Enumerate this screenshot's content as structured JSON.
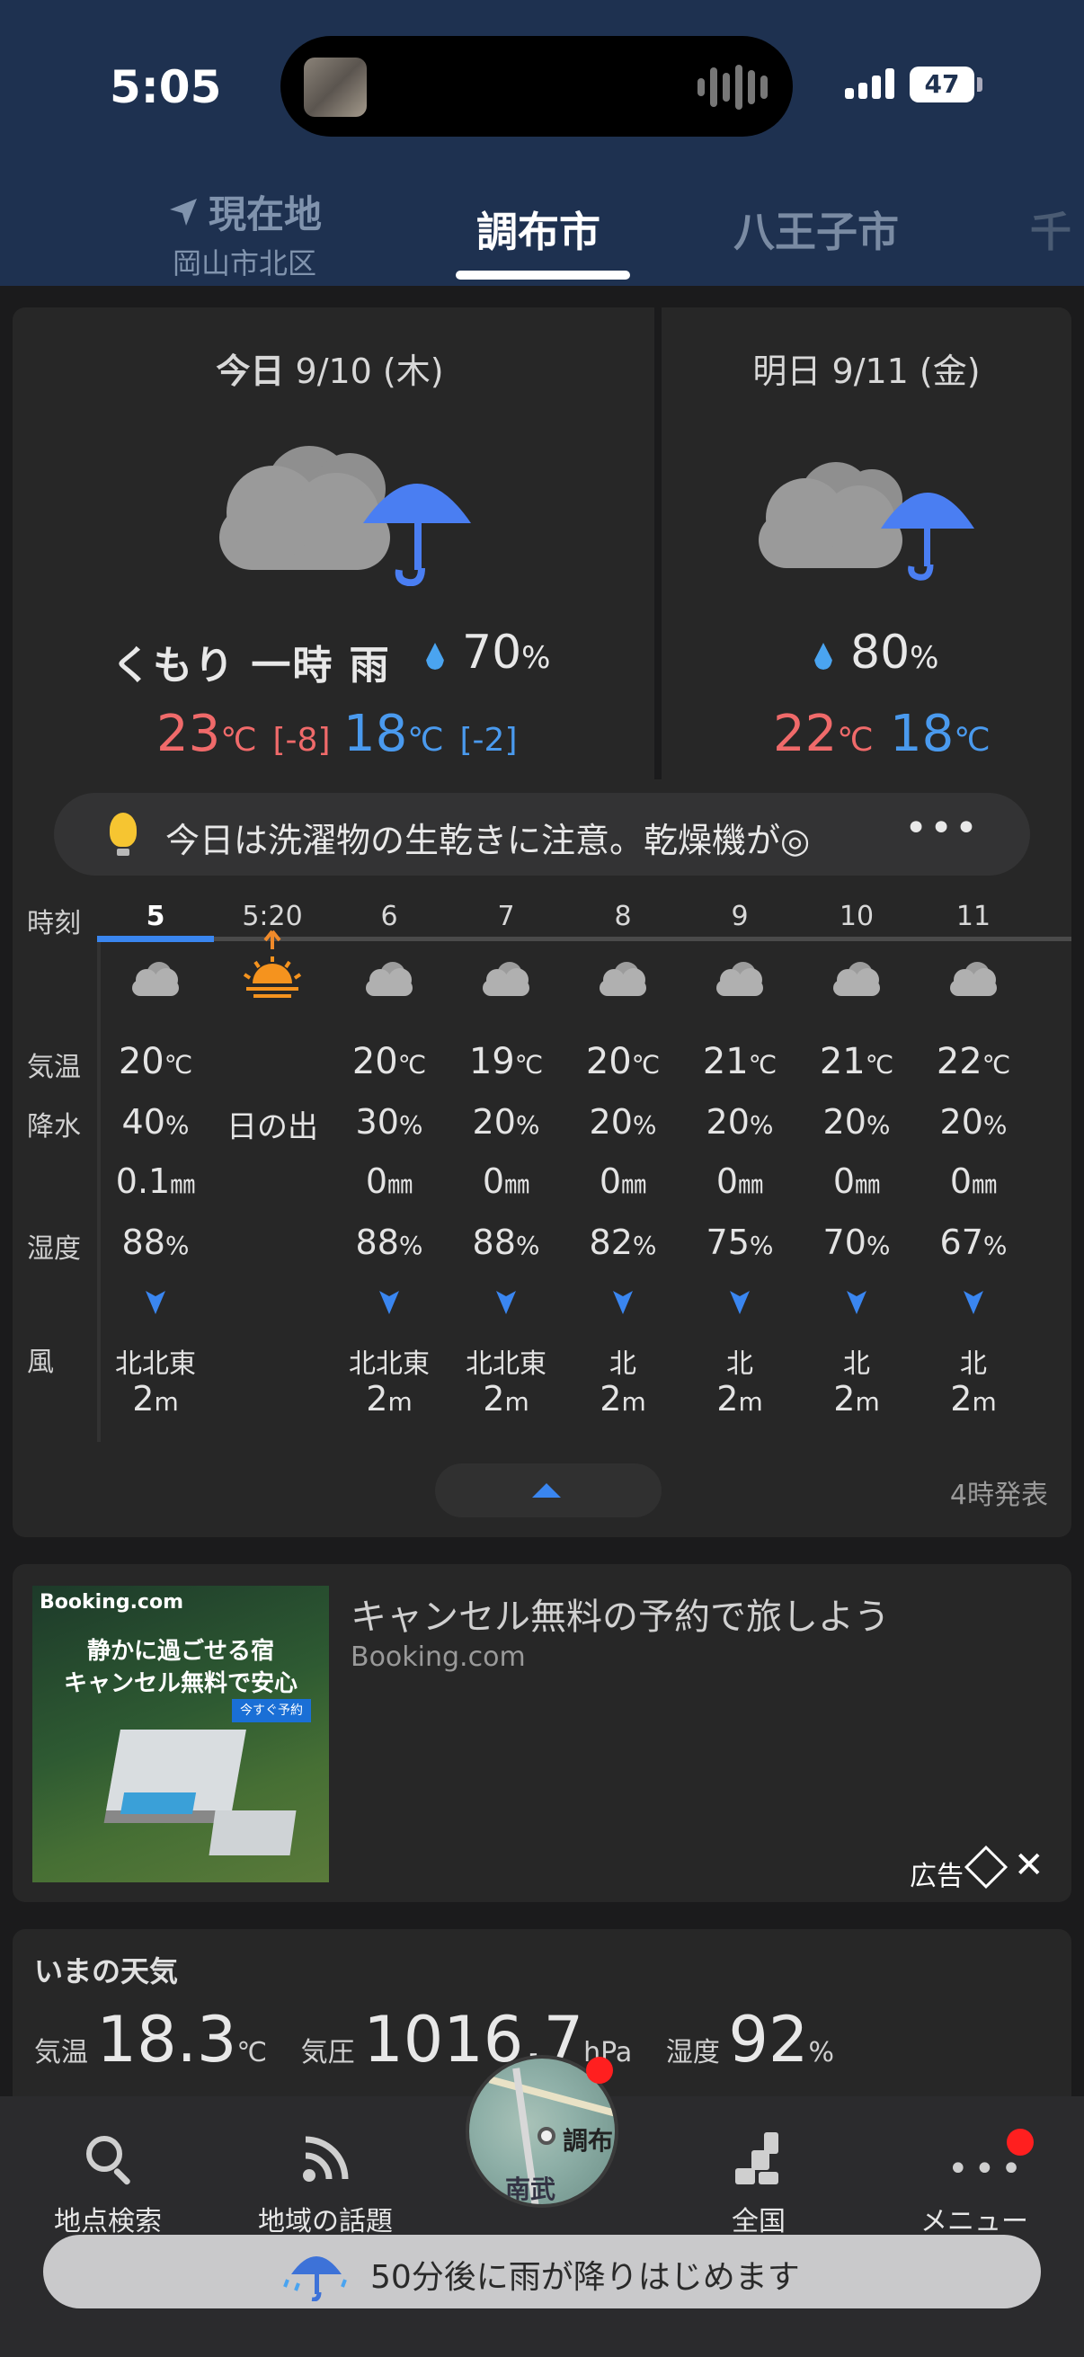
{
  "status_bar": {
    "time": "5:05",
    "battery": "47"
  },
  "location_tabs": {
    "current": {
      "title": "現在地",
      "subtitle": "岡山市北区"
    },
    "tabs": [
      "調布市",
      "八王子市",
      "千"
    ]
  },
  "forecast": {
    "today": {
      "label": "今日",
      "date": "9/10 (木)",
      "icon": "cloudy-with-rain-icon",
      "weather": "くもり 一時 雨",
      "pop_value": "70",
      "pop_unit": "%",
      "high": "23",
      "high_unit": "℃",
      "high_diff": "[-8]",
      "low": "18",
      "low_unit": "℃",
      "low_diff": "[-2]"
    },
    "tomorrow": {
      "label": "明日",
      "date": "9/11 (金)",
      "icon": "cloudy-with-rain-icon",
      "pop_value": "80",
      "pop_unit": "%",
      "high": "22",
      "high_unit": "℃",
      "low": "18",
      "low_unit": "℃"
    }
  },
  "advice": {
    "text": "今日は洗濯物の生乾きに注意。乾燥機が◎",
    "more": "•••"
  },
  "hourly": {
    "row_labels": {
      "time": "時刻",
      "temp": "気温",
      "rain": "降水",
      "humidity": "湿度",
      "wind": "風"
    },
    "columns": [
      {
        "time": "5",
        "icon": "cloud-icon",
        "temp": "20",
        "rain": "40",
        "mm": "0.1",
        "humidity": "88",
        "wind_dir": "北北東",
        "wind_speed": "2"
      },
      {
        "time": "5:20",
        "icon": "sunrise-icon",
        "sunrise": "日の出"
      },
      {
        "time": "6",
        "icon": "cloud-icon",
        "temp": "20",
        "rain": "30",
        "mm": "0",
        "humidity": "88",
        "wind_dir": "北北東",
        "wind_speed": "2"
      },
      {
        "time": "7",
        "icon": "cloud-icon",
        "temp": "19",
        "rain": "20",
        "mm": "0",
        "humidity": "88",
        "wind_dir": "北北東",
        "wind_speed": "2"
      },
      {
        "time": "8",
        "icon": "cloud-icon",
        "temp": "20",
        "rain": "20",
        "mm": "0",
        "humidity": "82",
        "wind_dir": "北",
        "wind_speed": "2"
      },
      {
        "time": "9",
        "icon": "cloud-icon",
        "temp": "21",
        "rain": "20",
        "mm": "0",
        "humidity": "75",
        "wind_dir": "北",
        "wind_speed": "2"
      },
      {
        "time": "10",
        "icon": "cloud-icon",
        "temp": "21",
        "rain": "20",
        "mm": "0",
        "humidity": "70",
        "wind_dir": "北",
        "wind_speed": "2"
      },
      {
        "time": "11",
        "icon": "cloud-icon",
        "temp": "22",
        "rain": "20",
        "mm": "0",
        "humidity": "67",
        "wind_dir": "北",
        "wind_speed": "2"
      }
    ],
    "units": {
      "temp": "℃",
      "rain": "%",
      "mm": "㎜",
      "humidity": "%",
      "wind": "m"
    },
    "issued": "4時発表"
  },
  "ad": {
    "image_brand": "Booking.com",
    "image_line1": "静かに過ごせる宿",
    "image_line2": "キャンセル無料で安心",
    "image_cta": "今すぐ予約",
    "title": "キャンセル無料の予約で旅しよう",
    "source": "Booking.com",
    "label": "広告"
  },
  "now": {
    "title": "いまの天気",
    "temp_label": "気温",
    "temp_value": "18.3",
    "temp_unit": "℃",
    "pressure_label": "気圧",
    "pressure_value": "1016.7",
    "pressure_unit": "hPa",
    "humidity_label": "湿度",
    "humidity_value": "92",
    "humidity_unit": "%"
  },
  "nav": {
    "search": "地点検索",
    "topics": "地域の話題",
    "radar_city": "調布",
    "radar_area": "南武",
    "national": "全国",
    "menu": "メニュー"
  },
  "rain_banner": "50分後に雨が降りはじめます",
  "colors": {
    "accent": "#3a86f0",
    "high_temp": "#f06a6a",
    "low_temp": "#4a9aee",
    "header": "#1e3150"
  }
}
